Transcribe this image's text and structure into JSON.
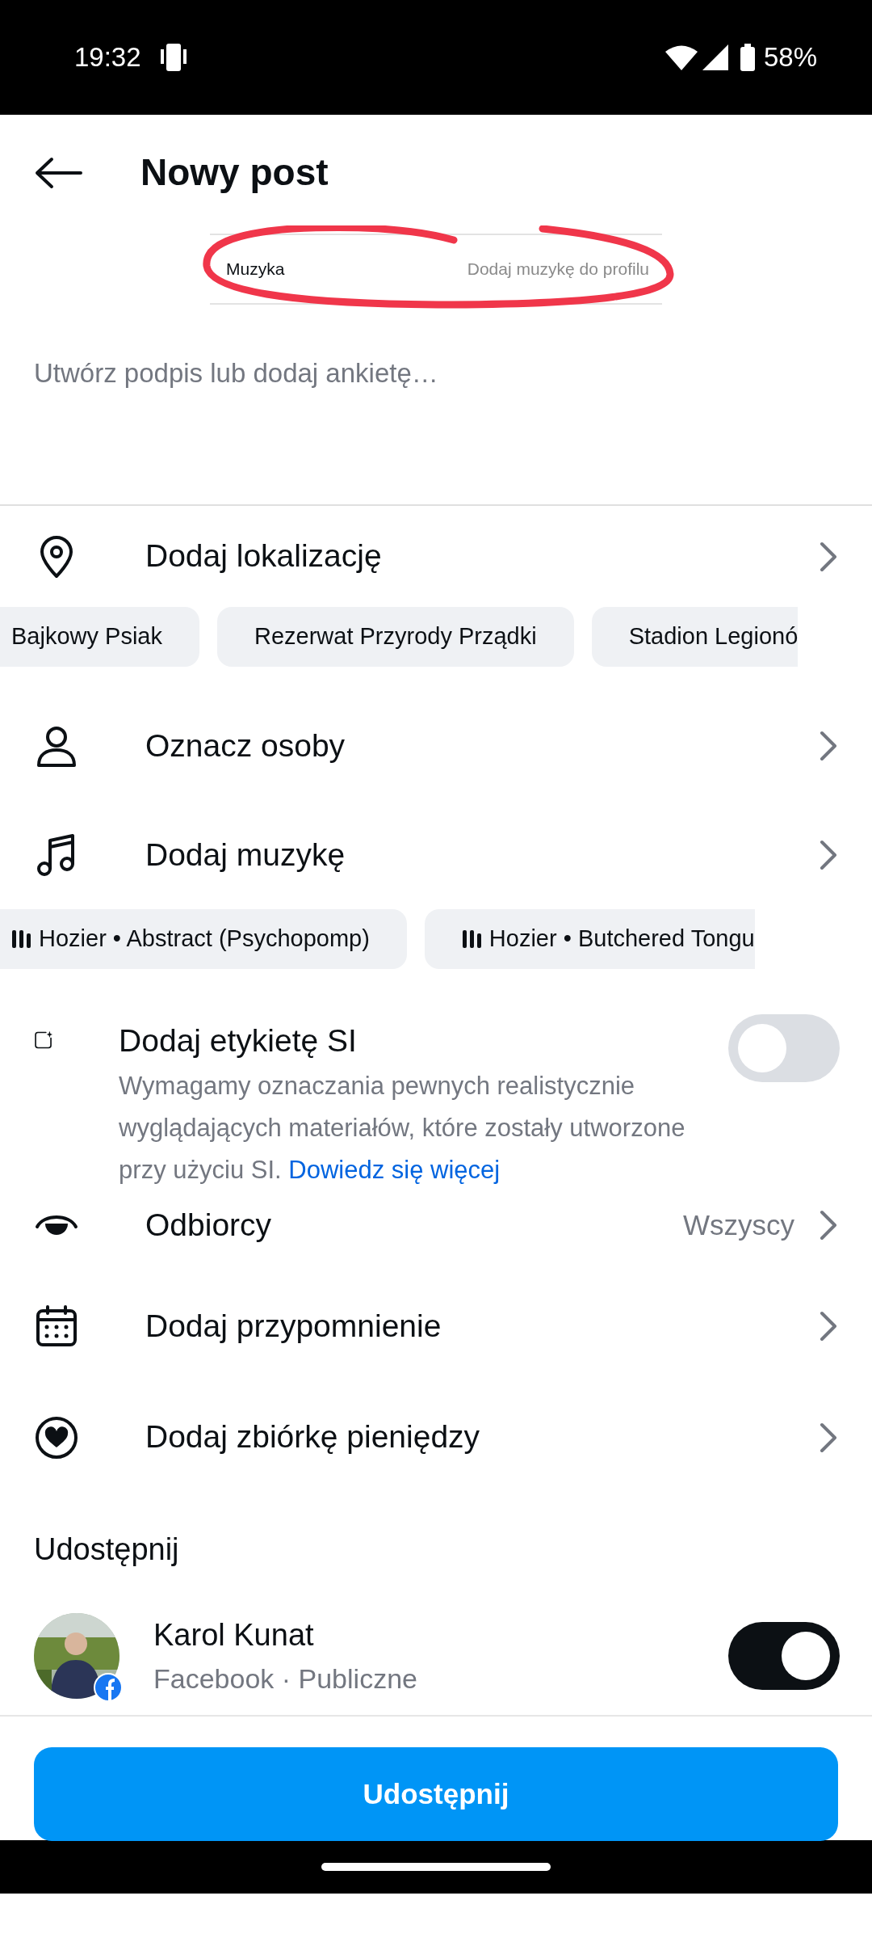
{
  "status_bar": {
    "time": "19:32",
    "battery": "58%"
  },
  "header": {
    "title": "Nowy post"
  },
  "preview": {
    "label": "Muzyka",
    "value": "Dodaj muzykę do profilu"
  },
  "caption": {
    "placeholder": "Utwórz podpis lub dodaj ankietę…"
  },
  "location": {
    "label": "Dodaj lokalizację",
    "suggestions": [
      "Bajkowy Psiak",
      "Rezerwat Przyrody Prządki",
      "Stadion Legionó"
    ]
  },
  "tag_people": {
    "label": "Oznacz osoby"
  },
  "music": {
    "label": "Dodaj muzykę",
    "suggestions": [
      "Hozier • Abstract (Psychopomp)",
      "Hozier • Butchered Tongu"
    ]
  },
  "ai_label": {
    "label": "Dodaj etykietę SI",
    "description": "Wymagamy oznaczania pewnych realistycznie wyglądających materiałów, które zostały utworzone przy użyciu SI.",
    "link": "Dowiedz się więcej",
    "on": false
  },
  "audience": {
    "label": "Odbiorcy",
    "value": "Wszyscy"
  },
  "reminder": {
    "label": "Dodaj przypomnienie"
  },
  "fundraiser": {
    "label": "Dodaj zbiórkę pieniędzy"
  },
  "share": {
    "heading": "Udostępnij",
    "accounts": [
      {
        "name": "Karol Kunat",
        "detail": "Facebook · Publiczne",
        "on": true
      }
    ]
  },
  "submit_button": "Udostępnij"
}
